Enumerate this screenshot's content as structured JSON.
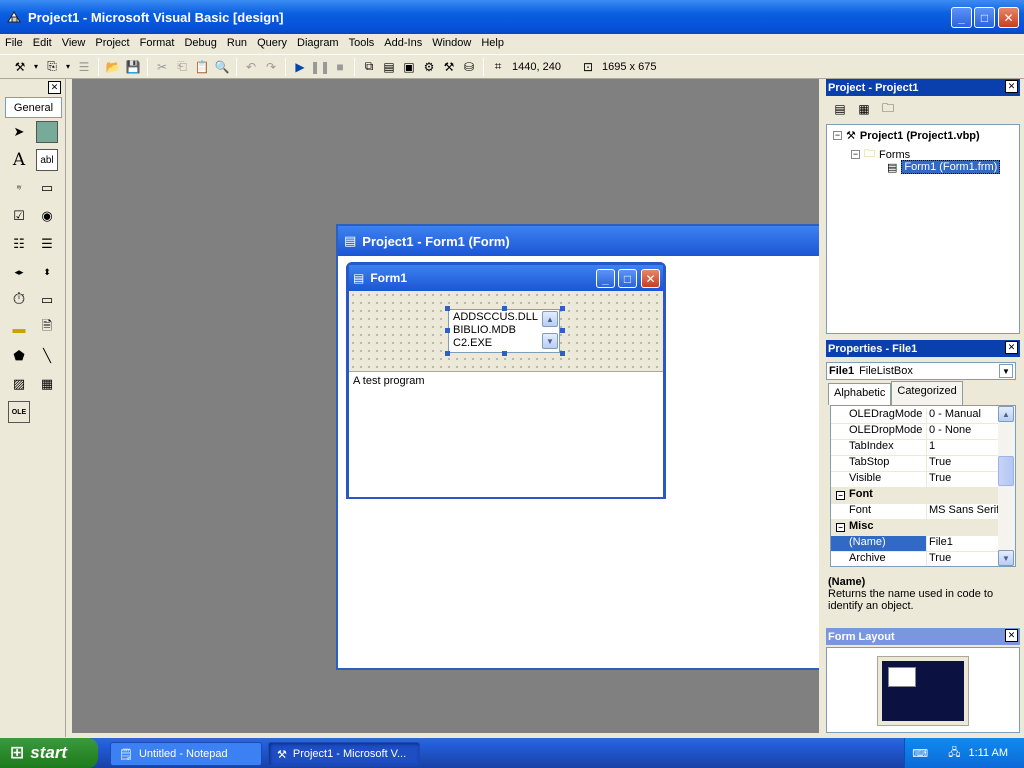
{
  "app": {
    "title": "Project1 - Microsoft Visual Basic [design]"
  },
  "menu": [
    "File",
    "Edit",
    "View",
    "Project",
    "Format",
    "Debug",
    "Run",
    "Query",
    "Diagram",
    "Tools",
    "Add-Ins",
    "Window",
    "Help"
  ],
  "toolbar": {
    "position": "1440, 240",
    "size": "1695 x 675"
  },
  "toolbox": {
    "tab": "General"
  },
  "designer": {
    "title": "Project1 - Form1 (Form)"
  },
  "form1": {
    "title": "Form1",
    "files": [
      "ADDSCCUS.DLL",
      "BIBLIO.MDB",
      "C2.EXE"
    ],
    "text": "A test program"
  },
  "project": {
    "title": "Project - Project1",
    "root": "Project1 (Project1.vbp)",
    "folder": "Forms",
    "form": "Form1 (Form1.frm)"
  },
  "properties": {
    "title": "Properties - File1",
    "object_name": "File1",
    "object_type": "FileListBox",
    "tab_alpha": "Alphabetic",
    "tab_cat": "Categorized",
    "rows": [
      {
        "name": "OLEDragMode",
        "value": "0 - Manual"
      },
      {
        "name": "OLEDropMode",
        "value": "0 - None"
      },
      {
        "name": "TabIndex",
        "value": "1"
      },
      {
        "name": "TabStop",
        "value": "True"
      },
      {
        "name": "Visible",
        "value": "True"
      },
      {
        "name": "Font",
        "value": ""
      },
      {
        "name": "Font",
        "value": "MS Sans Serif"
      },
      {
        "name": "Misc",
        "value": ""
      },
      {
        "name": "(Name)",
        "value": "File1"
      },
      {
        "name": "Archive",
        "value": "True"
      }
    ],
    "desc_title": "(Name)",
    "desc_text": "Returns the name used in code to identify an object."
  },
  "layout": {
    "title": "Form Layout"
  },
  "taskbar": {
    "start": "start",
    "tasks": [
      "Untitled - Notepad",
      "Project1 - Microsoft V..."
    ],
    "clock": "1:11 AM"
  },
  "colors": {
    "title_active": "#0a3fae",
    "title_inactive": "#7a96df",
    "workspace": "#808080",
    "face": "#ece9d8"
  }
}
